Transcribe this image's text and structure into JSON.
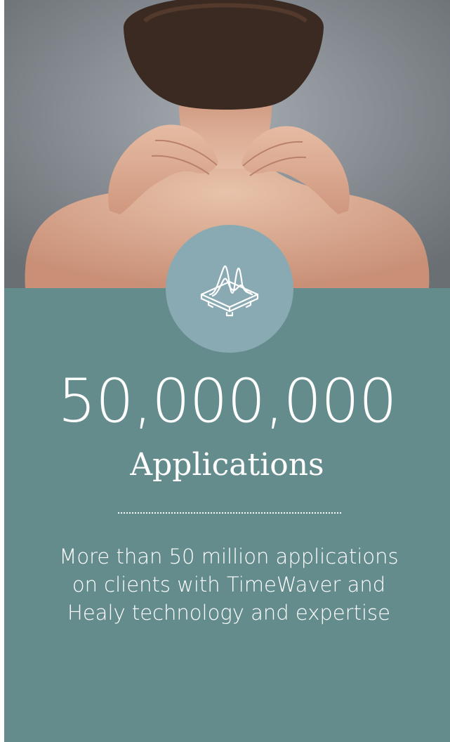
{
  "hero": {
    "image_description": "",
    "photo_colors": {
      "background_top": "#6f7378",
      "background_bottom": "#9aa1a7",
      "skin": "#d9a98f",
      "hair": "#3b2a22"
    }
  },
  "badge": {
    "icon": "healy-device-wave-icon",
    "background_color": "#8aaab3"
  },
  "stat": {
    "number": "50,000,000",
    "label": "Applications"
  },
  "description": "More than 50 million applications on clients with TimeWaver and Healy technology and expertise",
  "colors": {
    "panel": "#658c8c",
    "text": "#ffffff"
  }
}
